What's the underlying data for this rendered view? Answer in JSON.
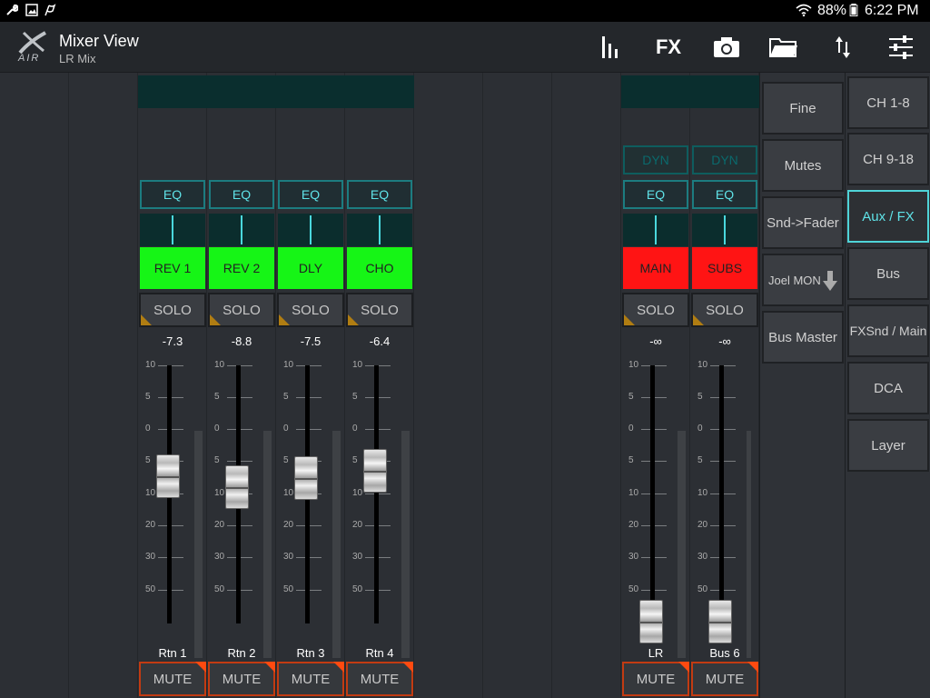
{
  "status_bar": {
    "battery": "88%",
    "time": "6:22 PM",
    "icons": [
      "wrench-icon",
      "image-icon",
      "flag-icon",
      "wifi-icon",
      "battery-icon"
    ]
  },
  "header": {
    "logo_text": "AIR",
    "title": "Mixer View",
    "subtitle": "LR Mix",
    "toolbar": {
      "meters_icon": "meters-icon",
      "fx_label": "FX",
      "camera_icon": "camera-icon",
      "folder_icon": "folder-icon",
      "transfer_icon": "up-down-arrows-icon",
      "settings_icon": "sliders-icon"
    }
  },
  "strip_common": {
    "eq_label": "EQ",
    "dyn_label": "DYN",
    "solo_label": "SOLO",
    "mute_label": "MUTE",
    "scale": [
      "10",
      "5",
      "0",
      "5",
      "10",
      "20",
      "30",
      "50"
    ]
  },
  "strips": [
    {
      "name": "REV 1",
      "label": "Rtn 1",
      "level": "-7.3",
      "color": "#16f516",
      "has_dyn": false,
      "fader_db": -7.3
    },
    {
      "name": "REV 2",
      "label": "Rtn 2",
      "level": "-8.8",
      "color": "#16f516",
      "has_dyn": false,
      "fader_db": -8.8
    },
    {
      "name": "DLY",
      "label": "Rtn 3",
      "level": "-7.5",
      "color": "#16f516",
      "has_dyn": false,
      "fader_db": -7.5
    },
    {
      "name": "CHO",
      "label": "Rtn 4",
      "level": "-6.4",
      "color": "#16f516",
      "has_dyn": false,
      "fader_db": -6.4
    },
    {
      "name": "MAIN",
      "label": "LR",
      "level": "-∞",
      "color": "#ff1414",
      "has_dyn": true,
      "fader_db": null
    },
    {
      "name": "SUBS",
      "label": "Bus 6",
      "level": "-∞",
      "color": "#ff1414",
      "has_dyn": true,
      "fader_db": null
    }
  ],
  "control_panel": {
    "fine": "Fine",
    "mutes": "Mutes",
    "snd_fader": "Snd->Fader",
    "joel_mon": "Joel MON",
    "bus_master": "Bus Master"
  },
  "layer_panel": {
    "ch_1_8": "CH 1-8",
    "ch_9_18": "CH 9-18",
    "aux_fx": "Aux / FX",
    "bus": "Bus",
    "fxsnd_main": "FXSnd / Main",
    "dca": "DCA",
    "layer": "Layer",
    "active": "Aux / FX"
  },
  "colors": {
    "accent_cyan": "#4fd4d8",
    "mute_orange": "#ff4a10",
    "solo_amber": "#b07d12"
  }
}
